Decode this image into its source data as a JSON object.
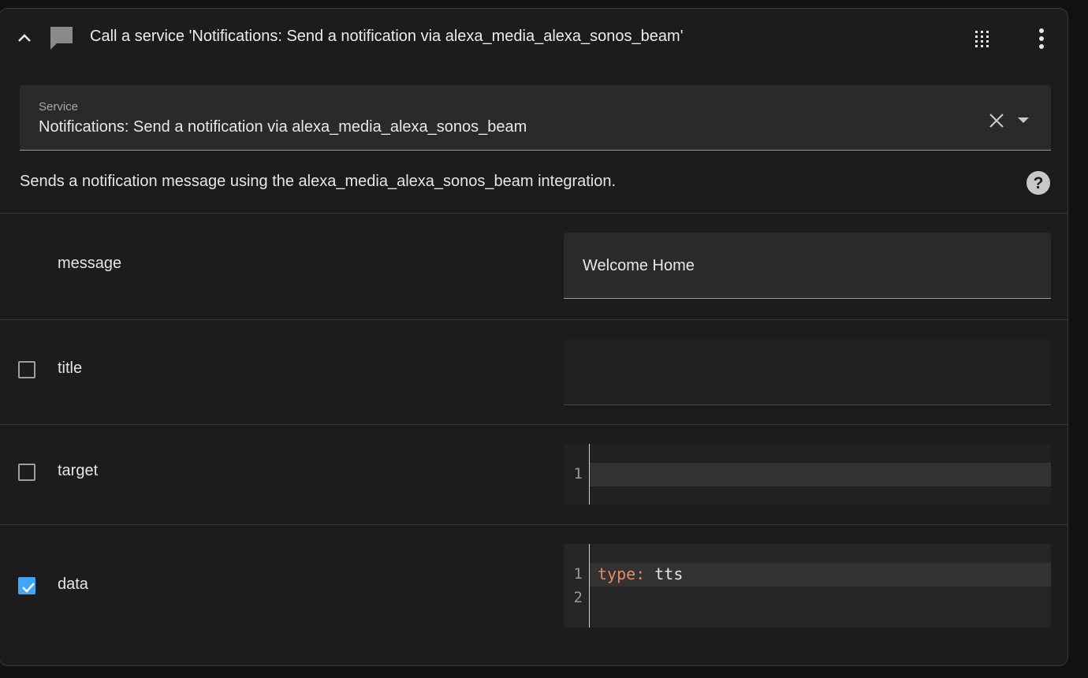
{
  "header": {
    "title": "Call a service 'Notifications: Send a notification via alexa_media_alexa_sonos_beam'"
  },
  "service": {
    "label": "Service",
    "value": "Notifications: Send a notification via alexa_media_alexa_sonos_beam"
  },
  "description": "Sends a notification message using the alexa_media_alexa_sonos_beam integration.",
  "fields": {
    "message": {
      "label": "message",
      "value": "Welcome Home"
    },
    "title": {
      "label": "title",
      "checked": false,
      "value": ""
    },
    "target": {
      "label": "target",
      "checked": false,
      "line_numbers": [
        "1"
      ]
    },
    "data": {
      "label": "data",
      "checked": true,
      "line_numbers": [
        "1",
        "2"
      ],
      "code": {
        "key": "type:",
        "value": " tts"
      }
    }
  },
  "colors": {
    "checkbox_accent": "#42a5f5",
    "yaml_key": "#e5896b",
    "background": "#1c1c1c"
  },
  "icons": [
    "chevron-up-icon",
    "message-icon",
    "drag-grid-icon",
    "more-vertical-icon",
    "close-icon",
    "dropdown-arrow-icon",
    "help-circle-icon",
    "checkmark-icon"
  ]
}
